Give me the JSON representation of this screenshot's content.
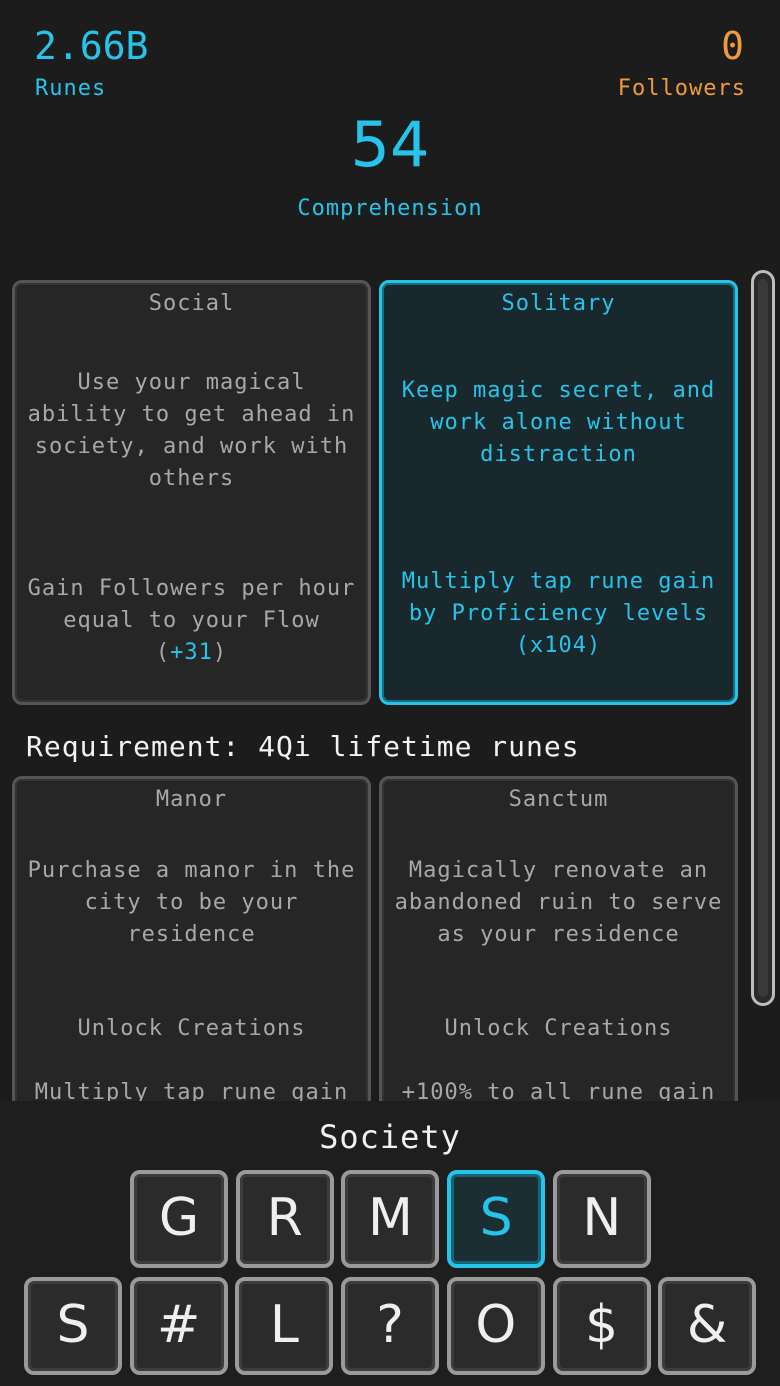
{
  "header": {
    "runes_value": "2.66B",
    "runes_label": "Runes",
    "followers_value": "0",
    "followers_label": "Followers",
    "comprehension_value": "54",
    "comprehension_label": "Comprehension"
  },
  "choices": [
    {
      "title": "Social",
      "description": "Use your magical ability to get ahead in society, and work with others",
      "effect_prefix": "Gain Followers per hour equal to your Flow (",
      "effect_value": "+31",
      "effect_suffix": ")",
      "selected": false
    },
    {
      "title": "Solitary",
      "description": "Keep magic secret, and work alone without distraction",
      "effect": "Multiply tap rune gain by Proficiency levels (x104)",
      "selected": true
    }
  ],
  "requirement": "Requirement: 4Qi lifetime runes",
  "residences": [
    {
      "title": "Manor",
      "description": "Purchase a manor in the city to be your residence",
      "effect": "Unlock Creations",
      "effect2": "Multiply tap rune gain"
    },
    {
      "title": "Sanctum",
      "description": "Magically renovate an abandoned ruin to serve as your residence",
      "effect": "Unlock Creations",
      "effect2": "+100% to all rune gain"
    }
  ],
  "footer": {
    "section_title": "Society",
    "row1": [
      "G",
      "R",
      "M",
      "S",
      "N"
    ],
    "row2": [
      "S",
      "#",
      "L",
      "?",
      "O",
      "$",
      "&"
    ],
    "active_row1_index": 3
  },
  "colors": {
    "accent": "#27c4ea",
    "followers": "#f09a3e",
    "background": "#1c1c1c"
  }
}
